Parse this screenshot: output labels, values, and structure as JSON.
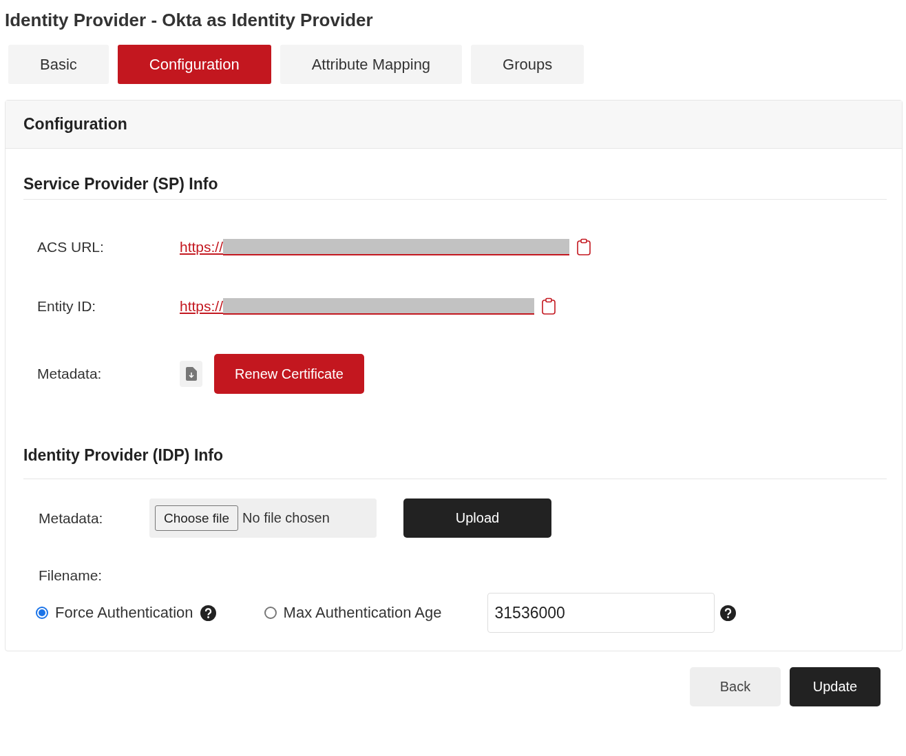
{
  "title": "Identity Provider - Okta as Identity Provider",
  "tabs": [
    {
      "label": "Basic",
      "selected": false
    },
    {
      "label": "Configuration",
      "selected": true
    },
    {
      "label": "Attribute Mapping",
      "selected": false
    },
    {
      "label": "Groups",
      "selected": false
    }
  ],
  "card": {
    "title": "Configuration",
    "sp_info": {
      "heading": "Service Provider (SP) Info",
      "rows": [
        {
          "kind": "link",
          "label": "ACS URL:",
          "link": "https://"
        },
        {
          "kind": "link",
          "label": "Entity ID:",
          "link": "https://"
        },
        {
          "kind": "metadata",
          "label": "Metadata:",
          "button": "Renew Certificate"
        }
      ]
    },
    "idp_info": {
      "heading": "Identity Provider (IDP) Info",
      "metadata_label": "Metadata:",
      "file_button": "Choose file",
      "file_status": "No file chosen",
      "upload_button": "Upload",
      "filename_label": "Filename:",
      "options": [
        {
          "label": "Force Authentication",
          "selected": true,
          "help": true
        },
        {
          "label": "Max Authentication Age",
          "selected": false,
          "help": false
        }
      ],
      "max_age": {
        "value": "31536000"
      }
    }
  },
  "buttons": [
    {
      "label": "Back",
      "kind": "secondary"
    },
    {
      "label": "Update",
      "kind": "primary"
    }
  ]
}
